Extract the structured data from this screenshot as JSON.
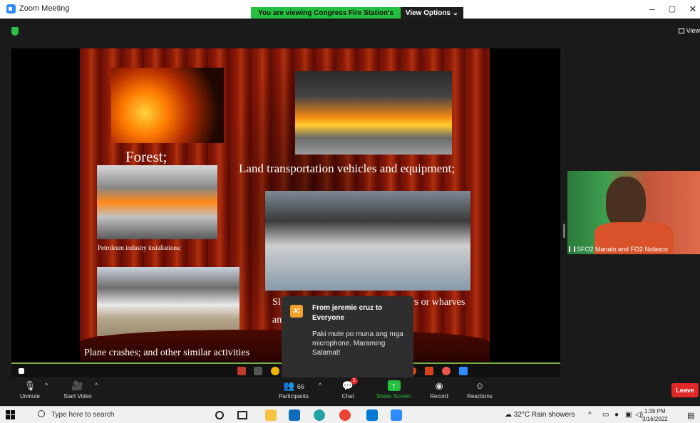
{
  "window": {
    "title": "Zoom Meeting",
    "share_banner": "You are viewing Congress Fire Station's screen",
    "view_options": "View Options ⌄",
    "minimize": "–",
    "restore": "▢",
    "close": "✕"
  },
  "meeting": {
    "view_button": "View"
  },
  "slide": {
    "forest": "Forest;",
    "land": "Land transportation vehicles and equipment;",
    "petroleum": "Petroleum industry installations;",
    "ships_partial": "Sl",
    "ships_tail": "rs or wharves",
    "and_partial": "an",
    "plane": "Plane crashes; and other similar activities"
  },
  "participant": {
    "name": "SFO2 Manalo and FO2 Nolasco"
  },
  "chat_toast": {
    "avatar": "JC",
    "from": "From jeremie cruz to Everyone",
    "message": "Paki mute po muna ang mga microphone. Maraming Salamat!"
  },
  "toolbar": {
    "unmute": "Unmute",
    "start_video": "Start Video",
    "participants": "Participants",
    "participant_count": "66",
    "chat": "Chat",
    "chat_badge": "1",
    "share_screen": "Share Screen",
    "record": "Record",
    "reactions": "Reactions",
    "leave": "Leave"
  },
  "taskbar": {
    "search_placeholder": "Type here to search",
    "weather": "32°C Rain showers",
    "time": "1:39 PM",
    "date": "3/16/2022"
  }
}
